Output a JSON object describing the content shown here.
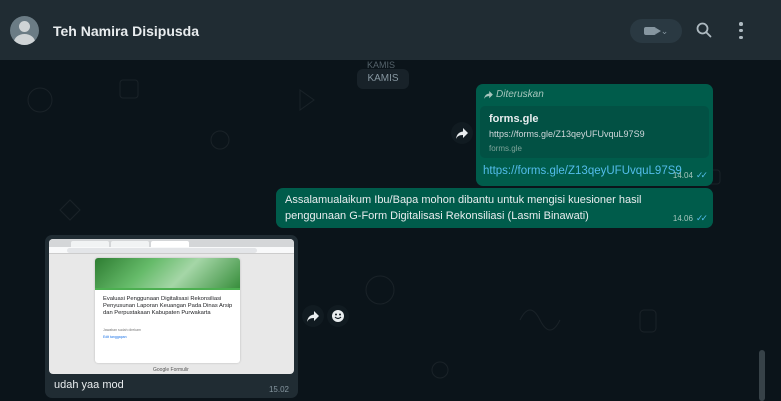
{
  "header": {
    "contact_name": "Teh Namira Disipusda",
    "icons": [
      "avatar-icon",
      "video-call-icon",
      "search-icon",
      "menu-icon"
    ]
  },
  "chat": {
    "date_ghost": "KAMIS",
    "date_label": "KAMIS",
    "messages": [
      {
        "direction": "outgoing",
        "forwarded_label": "Diteruskan",
        "preview_title": "forms.gle",
        "preview_url": "https://forms.gle/Z13qeyUFUvquL97S9",
        "preview_domain": "forms.gle",
        "text": "https://forms.gle/Z13qeyUFUvquL97S9",
        "time": "14.04"
      },
      {
        "direction": "outgoing",
        "text": "Assalamualaikum Ibu/Bapa mohon dibantu untuk mengisi kuesioner hasil penggunaan G-Form Digitalisasi Rekonsiliasi (Lasmi Binawati)",
        "time": "14.06"
      },
      {
        "direction": "incoming",
        "image": {
          "form_title": "Evaluasi Penggunaan Digitalisasi Rekonsiliasi Penyusunan Laporan Keuangan Pada Dinas Arsip dan Perpustakaan Kabupaten Purwakarta",
          "meta": "Jawaban sudah direkam",
          "link": "Edit tanggapan",
          "footer": "Google Formulir"
        },
        "caption": "udah yaa mod",
        "time": "15.02"
      }
    ]
  },
  "colors": {
    "header_bg": "#202c33",
    "chat_bg": "#0b141a",
    "outgoing_bubble": "#005c4b",
    "incoming_bubble": "#202c33",
    "link": "#53bdeb"
  }
}
